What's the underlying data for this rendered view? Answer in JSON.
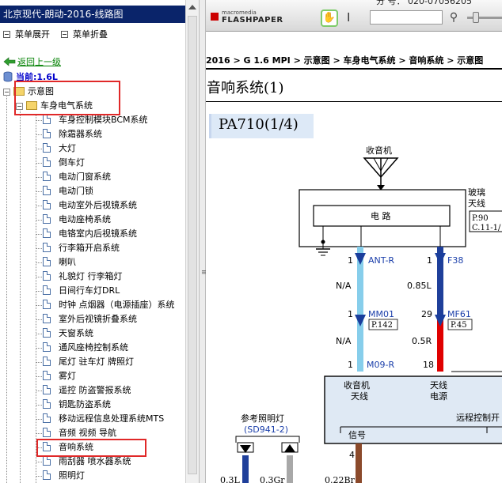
{
  "left_panel": {
    "title": "北京现代-朗动-2016-线路图",
    "expand_all": "菜单展开",
    "collapse_all": "菜单折叠",
    "back_link": "返回上一级",
    "current": "当前:1.6L"
  },
  "tree": {
    "root": "示意图",
    "folder": "车身电气系统",
    "items": [
      "车身控制模块BCM系统",
      "除霜器系统",
      "大灯",
      "倒车灯",
      "电动门窗系统",
      "电动门锁",
      "电动室外后视镜系统",
      "电动座椅系统",
      "电铬室内后视镜系统",
      "行李箱开启系统",
      "喇叭",
      "礼貌灯 行李箱灯",
      "日间行车灯DRL",
      "时钟 点烟器（电源插座）系统",
      "室外后视镜折叠系统",
      "天窗系统",
      "通风座椅控制系统",
      "尾灯 驻车灯 牌照灯",
      "雾灯",
      "遥控 防盗警报系统",
      "钥匙防盗系统",
      "移动远程信息处理系统MTS",
      "音频 视频 导航",
      "音响系统",
      "雨刮器 喷水器系统",
      "照明灯"
    ],
    "selected_index": 23
  },
  "viewer": {
    "logo_small": "macromedia",
    "logo_big": "FLASHPAPER",
    "top_cut_text": "分 号：  020-07056205",
    "search_value": "",
    "zoom_level": 0.2
  },
  "document": {
    "breadcrumb": "2016 > G 1.6 MPI > 示意图 > 车身电气系统 > 音响系统 > 示意图",
    "title": "音响系统(1)",
    "page_code": "PA710(1/4)"
  },
  "diagram": {
    "radio_label": "收音机",
    "circuit_label": "电 路",
    "glass_label": "玻璃",
    "antenna_label": "天线",
    "ref_p90": "P.90",
    "ref_c11": "C.11-1/",
    "pin1_num": "1",
    "pin1_name": "ANT-R",
    "pin_f38_num": "1",
    "pin_f38_name": "F38",
    "wire_na1": "N/A",
    "wire_085l": "0.85L",
    "mm01_num": "1",
    "mm01_name": "MM01",
    "mm01_ref": "P.142",
    "mf61_num": "29",
    "mf61_name": "MF61",
    "mf61_ref": "P.45",
    "wire_na2": "N/A",
    "wire_05r": "0.5R",
    "m09_num": "1",
    "m09_name": "M09-R",
    "pin_18": "18",
    "rx_antenna_1": "收音机",
    "rx_antenna_2": "天线",
    "ant_power_1": "天线",
    "ant_power_2": "电源",
    "remote_label": "远程控制开",
    "signal_label": "信号",
    "ref_light_label": "参考照明灯",
    "ref_light_code": "(SD941-2)",
    "pin_4": "4",
    "bottom_03l": "0.3L",
    "bottom_03gr": "0.3Gr",
    "bottom_022br": "0.22Br"
  }
}
